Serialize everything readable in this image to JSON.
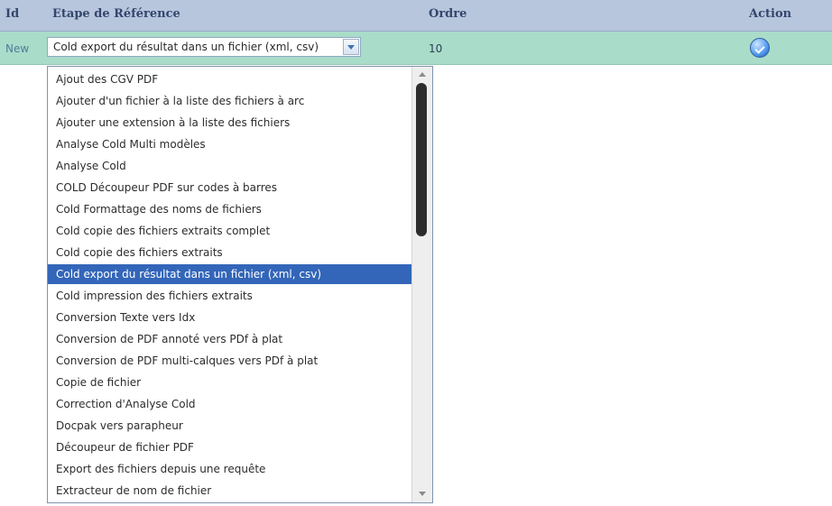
{
  "table": {
    "headers": {
      "id": "Id",
      "etape": "Etape de Référence",
      "ordre": "Ordre",
      "action": "Action"
    },
    "row": {
      "id": "New",
      "etape_selected": "Cold export du résultat dans un fichier (xml, csv)",
      "ordre": "10",
      "action_icon": "validate-icon"
    }
  },
  "dropdown": {
    "options": [
      "Ajout des CGV PDF",
      "Ajouter d'un fichier à la liste des fichiers à arc",
      "Ajouter une extension à la liste des fichiers",
      "Analyse Cold Multi modèles",
      "Analyse Cold",
      "COLD Découpeur PDF sur codes à barres",
      "Cold Formattage des noms de fichiers",
      "Cold copie des fichiers extraits complet",
      "Cold copie des fichiers extraits",
      "Cold export du résultat dans un fichier (xml, csv)",
      "Cold impression des fichiers extraits",
      "Conversion Texte vers Idx",
      "Conversion de PDF annoté vers PDf à plat",
      "Conversion de PDF multi-calques vers PDf à plat",
      "Copie de fichier",
      "Correction d'Analyse Cold",
      "Docpak vers parapheur",
      "Découpeur de fichier PDF",
      "Export des fichiers depuis une requête",
      "Extracteur de nom de fichier"
    ],
    "selected_index": 9
  }
}
